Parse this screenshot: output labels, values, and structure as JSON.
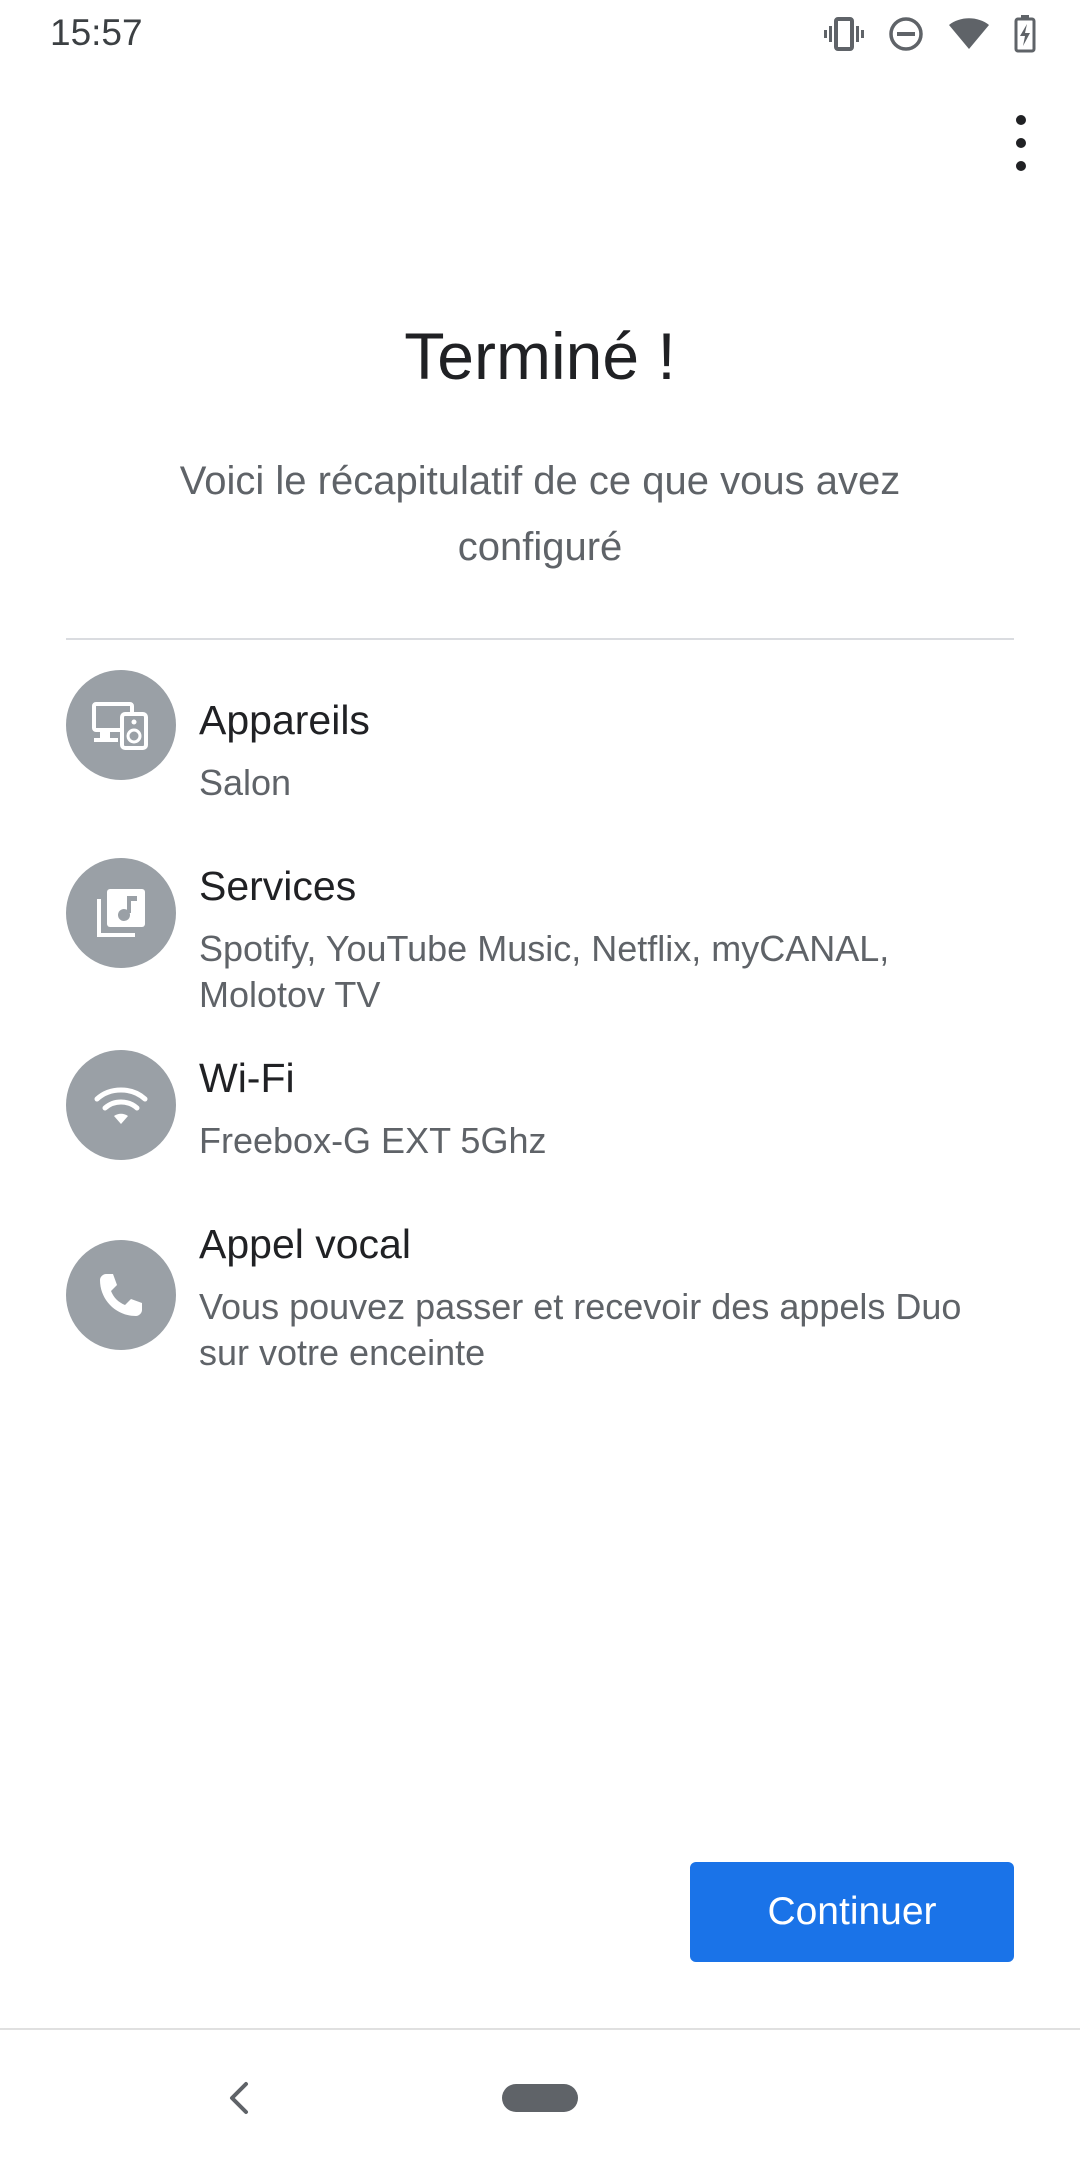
{
  "status_bar": {
    "time": "15:57",
    "icons": [
      "vibrate-icon",
      "do-not-disturb-icon",
      "wifi-icon",
      "battery-charging-icon"
    ]
  },
  "header": {
    "title": "Terminé !",
    "subtitle": "Voici le récapitulatif de ce que vous avez configuré"
  },
  "summary": {
    "items": [
      {
        "icon": "devices-icon",
        "title": "Appareils",
        "subtitle": "Salon"
      },
      {
        "icon": "music-library-icon",
        "title": "Services",
        "subtitle": "Spotify, YouTube Music, Netflix, myCANAL, Molotov TV"
      },
      {
        "icon": "wifi-icon",
        "title": "Wi-Fi",
        "subtitle": "Freebox-G EXT 5Ghz"
      },
      {
        "icon": "phone-icon",
        "title": "Appel vocal",
        "subtitle": "Vous pouvez passer et recevoir des appels Duo sur votre enceinte"
      }
    ]
  },
  "actions": {
    "continue_label": "Continuer"
  },
  "colors": {
    "accent": "#1a73e8",
    "icon_circle": "#9aa0a6",
    "secondary_text": "#5f6368"
  }
}
